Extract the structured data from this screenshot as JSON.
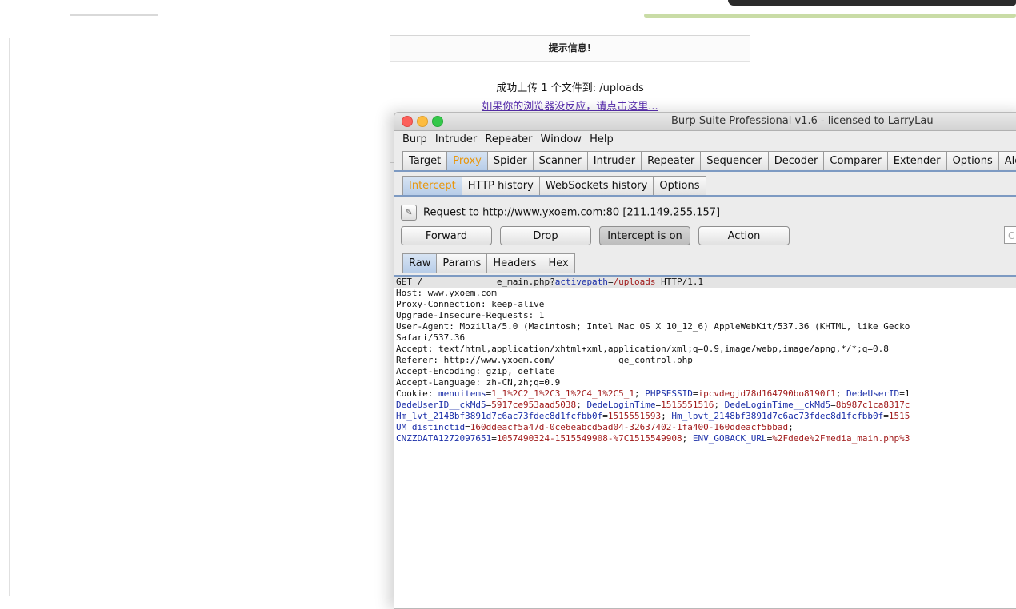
{
  "web_page": {
    "notice_title": "提示信息!",
    "notice_message": "成功上传 1 个文件到: /uploads",
    "notice_link": "如果你的浏览器没反应，请点击这里..."
  },
  "burp": {
    "window_title": "Burp Suite Professional v1.6 - licensed to LarryLau",
    "menu": [
      "Burp",
      "Intruder",
      "Repeater",
      "Window",
      "Help"
    ],
    "main_tabs": [
      "Target",
      "Proxy",
      "Spider",
      "Scanner",
      "Intruder",
      "Repeater",
      "Sequencer",
      "Decoder",
      "Comparer",
      "Extender",
      "Options",
      "Aler"
    ],
    "main_tab_selected": "Proxy",
    "proxy_tabs": [
      "Intercept",
      "HTTP history",
      "WebSockets history",
      "Options"
    ],
    "proxy_tab_selected": "Intercept",
    "request_info": "Request to http://www.yxoem.com:80  [211.149.255.157]",
    "buttons": {
      "forward": "Forward",
      "drop": "Drop",
      "intercept": "Intercept is on",
      "action": "Action"
    },
    "search_placeholder": "C",
    "view_tabs": [
      "Raw",
      "Params",
      "Headers",
      "Hex"
    ],
    "view_tab_selected": "Raw",
    "request_lines": [
      [
        {
          "t": "GET /"
        },
        {
          "t": "              "
        },
        {
          "t": "e_main.php?"
        },
        {
          "t": "activepath",
          "c": "b"
        },
        {
          "t": "="
        },
        {
          "t": "/uploads",
          "c": "r"
        },
        {
          "t": " HTTP/1.1"
        }
      ],
      [
        {
          "t": "Host: www.yxoem.com"
        }
      ],
      [
        {
          "t": "Proxy-Connection: keep-alive"
        }
      ],
      [
        {
          "t": "Upgrade-Insecure-Requests: 1"
        }
      ],
      [
        {
          "t": "User-Agent: Mozilla/5.0 (Macintosh; Intel Mac OS X 10_12_6) AppleWebKit/537.36 (KHTML, like Gecko"
        }
      ],
      [
        {
          "t": "Safari/537.36"
        }
      ],
      [
        {
          "t": "Accept: text/html,application/xhtml+xml,application/xml;q=0.9,image/webp,image/apng,*/*;q=0.8"
        }
      ],
      [
        {
          "t": "Referer: http://www.yxoem.com/"
        },
        {
          "t": "            "
        },
        {
          "t": "ge_control.php"
        }
      ],
      [
        {
          "t": "Accept-Encoding: gzip, deflate"
        }
      ],
      [
        {
          "t": "Accept-Language: zh-CN,zh;q=0.9"
        }
      ],
      [
        {
          "t": "Cookie: "
        },
        {
          "t": "menuitems",
          "c": "b"
        },
        {
          "t": "="
        },
        {
          "t": "1_1%2C2_1%2C3_1%2C4_1%2C5_1",
          "c": "r"
        },
        {
          "t": "; "
        },
        {
          "t": "PHPSESSID",
          "c": "b"
        },
        {
          "t": "="
        },
        {
          "t": "ipcvdegjd78d164790bo8190f1",
          "c": "r"
        },
        {
          "t": "; "
        },
        {
          "t": "DedeUserID",
          "c": "b"
        },
        {
          "t": "=1"
        }
      ],
      [
        {
          "t": "DedeUserID__ckMd5",
          "c": "b"
        },
        {
          "t": "="
        },
        {
          "t": "5917ce953aad5038",
          "c": "r"
        },
        {
          "t": "; "
        },
        {
          "t": "DedeLoginTime",
          "c": "b"
        },
        {
          "t": "="
        },
        {
          "t": "1515551516",
          "c": "r"
        },
        {
          "t": "; "
        },
        {
          "t": "DedeLoginTime__ckMd5",
          "c": "b"
        },
        {
          "t": "="
        },
        {
          "t": "8b987c1ca8317c",
          "c": "r"
        }
      ],
      [
        {
          "t": "Hm_lvt_2148bf3891d7c6ac73fdec8d1fcfbb0f",
          "c": "b"
        },
        {
          "t": "="
        },
        {
          "t": "1515551593",
          "c": "r"
        },
        {
          "t": "; "
        },
        {
          "t": "Hm_lpvt_2148bf3891d7c6ac73fdec8d1fcfbb0f",
          "c": "b"
        },
        {
          "t": "="
        },
        {
          "t": "1515",
          "c": "r"
        }
      ],
      [
        {
          "t": "UM_distinctid",
          "c": "b"
        },
        {
          "t": "="
        },
        {
          "t": "160ddeacf5a47d-0ce6eabcd5ad04-32637402-1fa400-160ddeacf5bbad",
          "c": "r"
        },
        {
          "t": ";"
        }
      ],
      [
        {
          "t": "CNZZDATA1272097651",
          "c": "b"
        },
        {
          "t": "="
        },
        {
          "t": "1057490324-1515549908-%7C1515549908",
          "c": "r"
        },
        {
          "t": "; "
        },
        {
          "t": "ENV_GOBACK_URL",
          "c": "b"
        },
        {
          "t": "="
        },
        {
          "t": "%2Fdede%2Fmedia_main.php%3",
          "c": "r"
        }
      ]
    ]
  }
}
